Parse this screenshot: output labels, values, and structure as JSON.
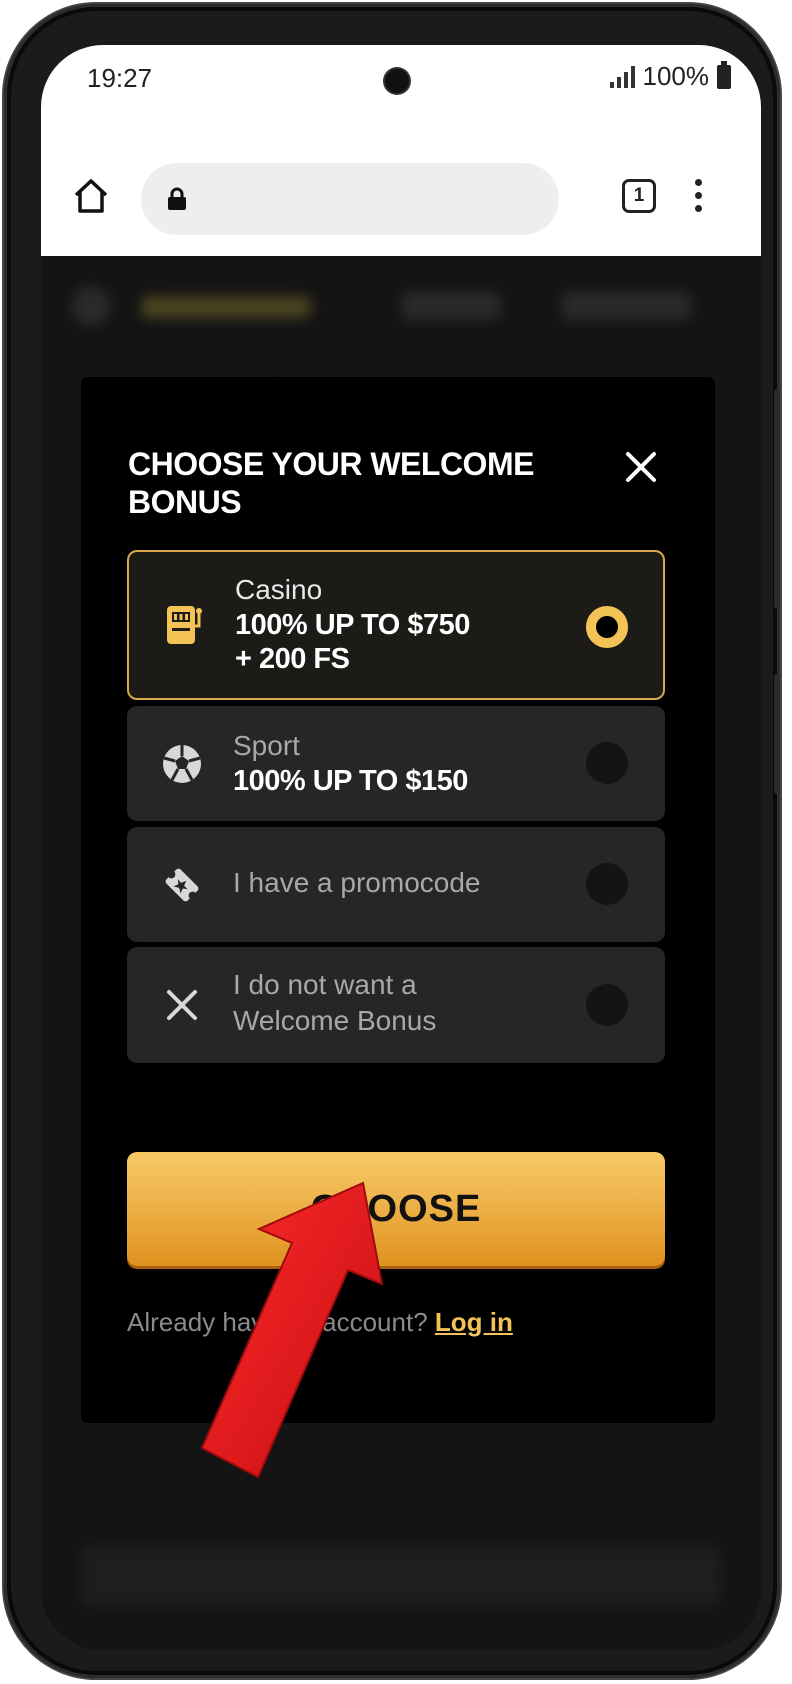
{
  "status": {
    "time": "19:27",
    "battery": "100%"
  },
  "browser": {
    "tab_count": "1"
  },
  "modal": {
    "title": "CHOOSE YOUR WELCOME BONUS",
    "options": [
      {
        "title": "Casino",
        "value_line1": "100% UP TO $750",
        "value_line2": "+ 200 FS",
        "icon": "slot-machine-icon",
        "selected": true
      },
      {
        "title": "Sport",
        "value_line1": "100% UP TO $150",
        "icon": "soccer-ball-icon",
        "selected": false
      },
      {
        "title": "I have a promocode",
        "icon": "ticket-icon",
        "selected": false
      },
      {
        "title_line1": "I do not want a",
        "title_line2": "Welcome Bonus",
        "icon": "x-icon",
        "selected": false
      }
    ],
    "cta_label": "CHOOSE",
    "login_prompt": "Already have an account?",
    "login_link": "Log in"
  },
  "colors": {
    "accent": "#f3c356",
    "cta_top": "#f7ca66",
    "cta_bottom": "#e0921e",
    "annotation_arrow": "#e8151b"
  }
}
